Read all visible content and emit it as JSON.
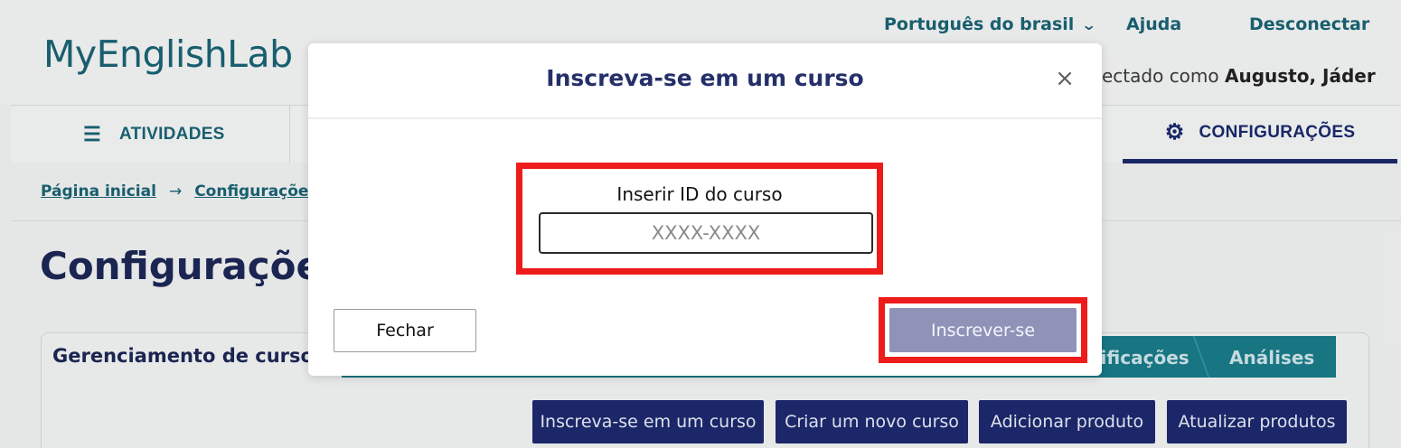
{
  "header": {
    "logo": "MyEnglishLab",
    "language": "Português do brasil",
    "help": "Ajuda",
    "logout": "Desconectar",
    "logged_as_prefix": "ectado como",
    "user_name": "Augusto, Jáder"
  },
  "nav": {
    "activities": "ATIVIDADES",
    "settings": "CONFIGURAÇÕES"
  },
  "breadcrumb": {
    "home": "Página inicial",
    "settings": "Configurações",
    "separator": "→"
  },
  "page": {
    "title": "Configurações",
    "tabs": [
      "Gerenciamento de cursos",
      "tificações",
      "Análises"
    ]
  },
  "actions": {
    "enroll": "Inscreva-se em um curso",
    "create": "Criar um novo curso",
    "add_product": "Adicionar produto",
    "update_products": "Atualizar produtos"
  },
  "modal": {
    "title": "Inscreva-se em um curso",
    "close_icon": "×",
    "id_label": "Inserir ID do curso",
    "id_placeholder": "XXXX-XXXX",
    "id_value": "",
    "close_button": "Fechar",
    "submit_button": "Inscrever-se"
  },
  "colors": {
    "brand_teal": "#1a6474",
    "navy": "#1d2756",
    "highlight_red": "#ee1b1b",
    "disabled_button": "#8f93b8"
  }
}
